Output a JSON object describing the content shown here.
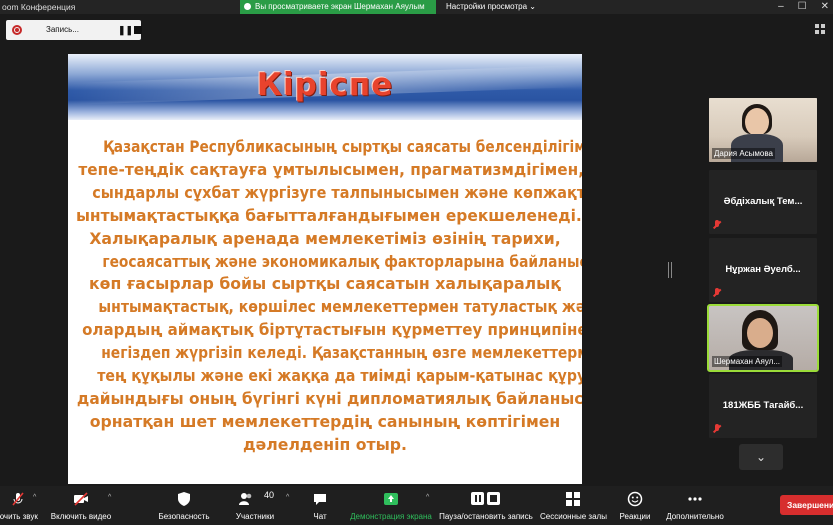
{
  "window": {
    "title": "oom Конференция",
    "share_banner": "Вы просматриваете экран Шермахан Аяулым",
    "view_options": "Настройки просмотра ⌄"
  },
  "recording": {
    "label": "Запись..."
  },
  "slide": {
    "title": "Кіріспе",
    "lines": [
      "Қазақстан Республикасының сыртқы саясаты белсенділігімен,",
      "тепе-теңдік сақтауға ұмтылысымен, прагматизмдігімен,",
      "сындарлы сұхбат жүргізуге талпынысымен және көпжақты",
      "ынтымақтастыққа бағытталғандығымен ерекшеленеді.",
      "Халықаралық аренада мемлекетіміз өзінің тарихи,",
      "геосаясаттық және экономикалық факторларына байланысты",
      "көп ғасырлар бойы сыртқы саясатын халықаралық",
      "ынтымақтастық, көршілес мемлекеттермен татуластық және",
      "олардың аймақтық біртұтастығын құрметтеу принципіне",
      "негіздеп жүргізіп келеді. Қазақстанның өзге мемлекеттермен",
      "тең құқылы және екі жаққа да тиімді қарым-қатынас құруға",
      "дайындығы оның бүгінгі күні дипломатиялық байланыс",
      "орнатқан шет мемлекеттердің санының көптігімен",
      "дәлелденіп отыр."
    ]
  },
  "participants": [
    {
      "name": "Дария Асымова",
      "video": true,
      "muted": false
    },
    {
      "name": "Әбдіхалық Тем...",
      "video": false,
      "muted": true
    },
    {
      "name": "Нұржан  Әуелб...",
      "video": false,
      "muted": true
    },
    {
      "name": "Шермахан Аяул...",
      "video": true,
      "muted": false,
      "active": true
    },
    {
      "name": "181ЖББ Тагайб...",
      "video": false,
      "muted": true
    }
  ],
  "toolbar": {
    "unmute": "ючить звук",
    "start_video": "Включить видео",
    "security": "Безопасность",
    "participants": "Участники",
    "participants_count": "40",
    "chat": "Чат",
    "share_screen": "Демонстрация экрана",
    "pause_record": "Пауза/остановить запись",
    "breakout": "Сессионные залы",
    "reactions": "Реакции",
    "more": "Дополнительно",
    "end": "Завершение"
  },
  "colors": {
    "share_green": "#2a9c46",
    "slide_text": "#d57a26",
    "slide_title": "#e8432d",
    "end_red": "#d72e2e",
    "active_outline": "#9bdc39"
  }
}
